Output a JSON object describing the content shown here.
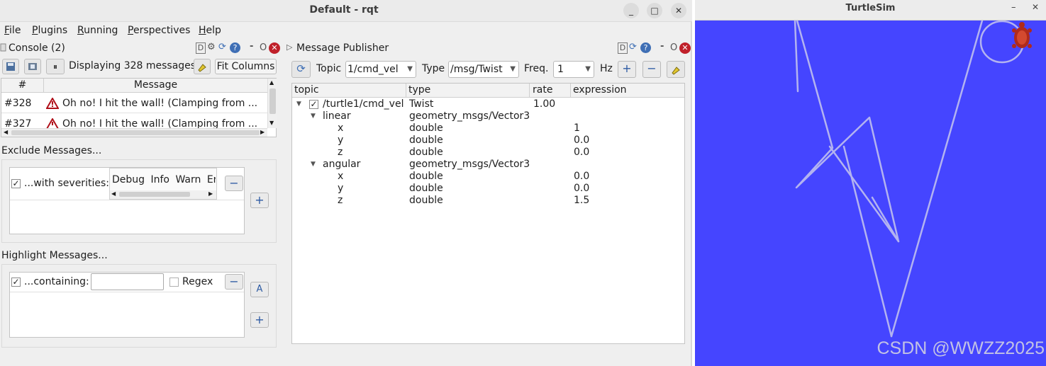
{
  "rqt": {
    "title": "Default - rqt",
    "controls": {
      "minimize": "_",
      "maximize": "□",
      "close": "✕"
    },
    "menu": [
      {
        "label": "File",
        "u": "F",
        "rest": "ile"
      },
      {
        "label": "Plugins",
        "u": "P",
        "rest": "lugins"
      },
      {
        "label": "Running",
        "u": "R",
        "rest": "unning"
      },
      {
        "label": "Perspectives",
        "u": "P",
        "rest": "erspectives"
      },
      {
        "label": "Help",
        "u": "H",
        "rest": "elp"
      }
    ]
  },
  "console": {
    "title": "Console (2)",
    "dock_buttons": {
      "d": "D",
      "dash": "-",
      "o": "O"
    },
    "displaying": "Displaying 328 messages",
    "fit_columns": "Fit Columns",
    "columns": {
      "num": "#",
      "message": "Message"
    },
    "rows": [
      {
        "num": "#328",
        "message": "Oh no! I hit the wall! (Clamping from ..."
      },
      {
        "num": "#327",
        "message": "Oh no! I hit the wall! (Clamping from ..."
      }
    ],
    "exclude": {
      "heading": "Exclude Messages...",
      "severities_label": "...with severities:",
      "severities": [
        "Debug",
        "Info",
        "Warn",
        "Err"
      ]
    },
    "highlight": {
      "heading": "Highlight Messages...",
      "containing_label": "...containing:",
      "containing_value": "",
      "regex_label": "Regex"
    }
  },
  "publisher": {
    "title": "Message Publisher",
    "dock_buttons": {
      "d": "D",
      "dash": "-",
      "o": "O"
    },
    "topic_label": "Topic",
    "topic_value": "1/cmd_vel",
    "type_label": "Type",
    "type_value": "/msg/Twist",
    "freq_label": "Freq.",
    "freq_value": "1",
    "hz_label": "Hz",
    "columns": {
      "topic": "topic",
      "type": "type",
      "rate": "rate",
      "expression": "expression"
    },
    "tree": [
      {
        "topic": "/turtle1/cmd_vel",
        "type": "Twist",
        "rate": "1.00",
        "expression": ""
      },
      {
        "topic": "linear",
        "type": "geometry_msgs/Vector3",
        "rate": "",
        "expression": ""
      },
      {
        "topic": "x",
        "type": "double",
        "rate": "",
        "expression": "1"
      },
      {
        "topic": "y",
        "type": "double",
        "rate": "",
        "expression": "0.0"
      },
      {
        "topic": "z",
        "type": "double",
        "rate": "",
        "expression": "0.0"
      },
      {
        "topic": "angular",
        "type": "geometry_msgs/Vector3",
        "rate": "",
        "expression": ""
      },
      {
        "topic": "x",
        "type": "double",
        "rate": "",
        "expression": "0.0"
      },
      {
        "topic": "y",
        "type": "double",
        "rate": "",
        "expression": "0.0"
      },
      {
        "topic": "z",
        "type": "double",
        "rate": "",
        "expression": "1.5"
      }
    ]
  },
  "turtlesim": {
    "title": "TurtleSim",
    "controls": {
      "minimize": "–",
      "close": "✕"
    },
    "background_color": "#4545ff",
    "path_color": "#b3b3f0",
    "watermark": "CSDN @WWZZ2025"
  }
}
